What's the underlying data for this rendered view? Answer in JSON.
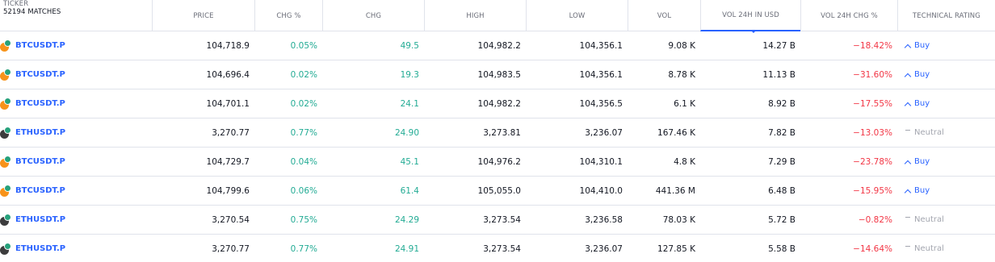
{
  "header": {
    "ticker_label": "TICKER",
    "matches": "52194 MATCHES",
    "columns": [
      "PRICE",
      "CHG %",
      "CHG",
      "HIGH",
      "LOW",
      "VOL",
      "VOL 24H IN USD",
      "VOL 24H CHG %",
      "TECHNICAL RATING"
    ],
    "sorted_column": "VOL 24H IN USD"
  },
  "rows": [
    {
      "symbol": "BTCUSDT.P",
      "coin": "btc-usdt-icon",
      "price": "104,718.9",
      "chg_pct": "0.05%",
      "chg": "49.5",
      "high": "104,982.2",
      "low": "104,356.1",
      "vol": "9.08 K",
      "vol24h_usd": "14.27 B",
      "vol24h_chg": "−18.42%",
      "rating": "Buy"
    },
    {
      "symbol": "BTCUSDT.P",
      "coin": "btc-usdt-icon",
      "price": "104,696.4",
      "chg_pct": "0.02%",
      "chg": "19.3",
      "high": "104,983.5",
      "low": "104,356.1",
      "vol": "8.78 K",
      "vol24h_usd": "11.13 B",
      "vol24h_chg": "−31.60%",
      "rating": "Buy"
    },
    {
      "symbol": "BTCUSDT.P",
      "coin": "btc-usdt-icon",
      "price": "104,701.1",
      "chg_pct": "0.02%",
      "chg": "24.1",
      "high": "104,982.2",
      "low": "104,356.5",
      "vol": "6.1 K",
      "vol24h_usd": "8.92 B",
      "vol24h_chg": "−17.55%",
      "rating": "Buy"
    },
    {
      "symbol": "ETHUSDT.P",
      "coin": "eth-usdt-icon",
      "price": "3,270.77",
      "chg_pct": "0.77%",
      "chg": "24.90",
      "high": "3,273.81",
      "low": "3,236.07",
      "vol": "167.46 K",
      "vol24h_usd": "7.82 B",
      "vol24h_chg": "−13.03%",
      "rating": "Neutral"
    },
    {
      "symbol": "BTCUSDT.P",
      "coin": "btc-usdt-icon",
      "price": "104,729.7",
      "chg_pct": "0.04%",
      "chg": "45.1",
      "high": "104,976.2",
      "low": "104,310.1",
      "vol": "4.8 K",
      "vol24h_usd": "7.29 B",
      "vol24h_chg": "−23.78%",
      "rating": "Buy"
    },
    {
      "symbol": "BTCUSDT.P",
      "coin": "btc-usdt-icon",
      "price": "104,799.6",
      "chg_pct": "0.06%",
      "chg": "61.4",
      "high": "105,055.0",
      "low": "104,410.0",
      "vol": "441.36 M",
      "vol24h_usd": "6.48 B",
      "vol24h_chg": "−15.95%",
      "rating": "Buy"
    },
    {
      "symbol": "ETHUSDT.P",
      "coin": "eth-usdt-icon",
      "price": "3,270.54",
      "chg_pct": "0.75%",
      "chg": "24.29",
      "high": "3,273.54",
      "low": "3,236.58",
      "vol": "78.03 K",
      "vol24h_usd": "5.72 B",
      "vol24h_chg": "−0.82%",
      "rating": "Neutral"
    },
    {
      "symbol": "ETHUSDT.P",
      "coin": "eth-usdt-icon",
      "price": "3,270.77",
      "chg_pct": "0.77%",
      "chg": "24.91",
      "high": "3,273.54",
      "low": "3,236.07",
      "vol": "127.85 K",
      "vol24h_usd": "5.58 B",
      "vol24h_chg": "−14.64%",
      "rating": "Neutral"
    }
  ],
  "colors": {
    "positive": "#22ab94",
    "negative": "#f23645",
    "accent": "#2962ff",
    "neutral": "#a3a6af"
  }
}
